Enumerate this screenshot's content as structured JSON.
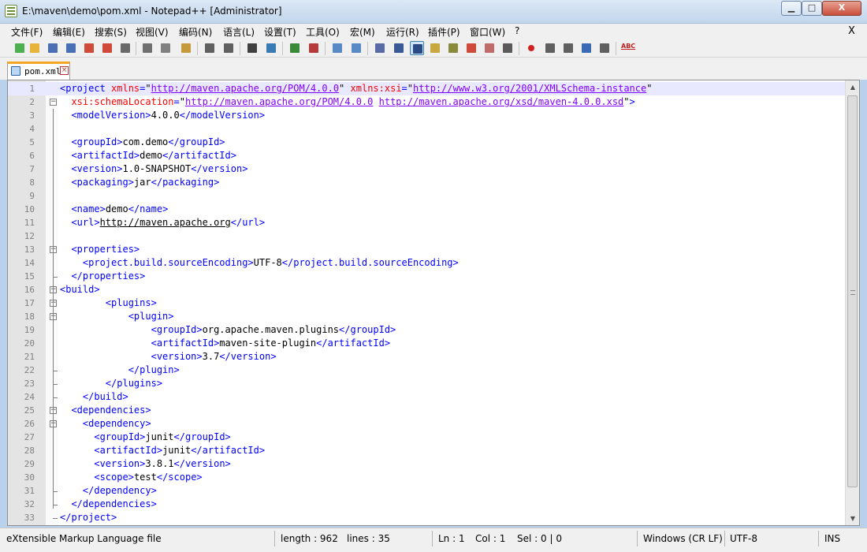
{
  "window": {
    "title": "E:\\maven\\demo\\pom.xml - Notepad++ [Administrator]",
    "minimize_label": "▁",
    "maximize_label": "□",
    "close_label": "X"
  },
  "menu": {
    "items": [
      "文件(F)",
      "编辑(E)",
      "搜索(S)",
      "视图(V)",
      "编码(N)",
      "语言(L)",
      "设置(T)",
      "工具(O)",
      "宏(M)",
      "运行(R)",
      "插件(P)",
      "窗口(W)",
      "?"
    ],
    "doc_close": "X"
  },
  "toolbar": {
    "icons": [
      "new-file-icon",
      "open-file-icon",
      "save-icon",
      "save-all-icon",
      "close-icon",
      "close-all-icon",
      "print-icon",
      "cut-icon",
      "copy-icon",
      "paste-icon",
      "undo-icon",
      "redo-icon",
      "find-icon",
      "replace-icon",
      "zoom-in-icon",
      "zoom-out-icon",
      "sync-v-icon",
      "sync-h-icon",
      "word-wrap-icon",
      "show-all-chars-icon",
      "indent-guide-icon",
      "doc-map-icon",
      "function-list-icon",
      "folder-workspace-icon",
      "monitor-icon",
      "eye-icon",
      "record-macro-icon",
      "stop-macro-icon",
      "play-macro-icon",
      "run-macro-multiple-icon",
      "save-macro-icon",
      "spell-check-icon"
    ],
    "colors": [
      "#4caf50",
      "#e8b33a",
      "#4a6fb5",
      "#4a6fb5",
      "#d04a3a",
      "#d04a3a",
      "#6a6a6a",
      "#707070",
      "#808080",
      "#c49a3c",
      "#606060",
      "#606060",
      "#404040",
      "#3a7ab5",
      "#3a8a3a",
      "#b53a3a",
      "#5a8ac5",
      "#5a8ac5",
      "#5a6aa5",
      "#3a5a95",
      "#2a4a85",
      "#c8a840",
      "#8a8a3a",
      "#d04a3a",
      "#c06a6a",
      "#5a5a5a",
      "#d02020",
      "#606060",
      "#606060",
      "#3a6ab5",
      "#606060",
      "#c02020"
    ],
    "spell_label": "ABC"
  },
  "tab": {
    "label": "pom.xml",
    "close": "×"
  },
  "editor": {
    "lines": [
      {
        "n": "1",
        "html": "<span class=\"t\">&lt;project</span> <span class=\"a\">xmlns</span><span class=\"t\">=</span><span class=\"q\">\"</span><span class=\"v\">http://maven.apache.org/POM/4.0.0</span><span class=\"q\">\"</span> <span class=\"a\">xmlns:xsi</span><span class=\"t\">=</span><span class=\"q\">\"</span><span class=\"v\">http://www.w3.org/2001/XMLSchema-instance</span><span class=\"q\">\"</span>"
      },
      {
        "n": "2",
        "html": "  <span class=\"a\">xsi:schemaLocation</span><span class=\"t\">=</span><span class=\"q\">\"</span><span class=\"v\">http://maven.apache.org/POM/4.0.0</span> <span class=\"v\">http://maven.apache.org/xsd/maven-4.0.0.xsd</span><span class=\"q\">\"</span><span class=\"t\">&gt;</span>"
      },
      {
        "n": "3",
        "html": "  <span class=\"t\">&lt;modelVersion&gt;</span>4.0.0<span class=\"t\">&lt;/modelVersion&gt;</span>"
      },
      {
        "n": "4",
        "html": ""
      },
      {
        "n": "5",
        "html": "  <span class=\"t\">&lt;groupId&gt;</span>com.demo<span class=\"t\">&lt;/groupId&gt;</span>"
      },
      {
        "n": "6",
        "html": "  <span class=\"t\">&lt;artifactId&gt;</span>demo<span class=\"t\">&lt;/artifactId&gt;</span>"
      },
      {
        "n": "7",
        "html": "  <span class=\"t\">&lt;version&gt;</span>1.0-SNAPSHOT<span class=\"t\">&lt;/version&gt;</span>"
      },
      {
        "n": "8",
        "html": "  <span class=\"t\">&lt;packaging&gt;</span>jar<span class=\"t\">&lt;/packaging&gt;</span>"
      },
      {
        "n": "9",
        "html": ""
      },
      {
        "n": "10",
        "html": "  <span class=\"t\">&lt;name&gt;</span>demo<span class=\"t\">&lt;/name&gt;</span>"
      },
      {
        "n": "11",
        "html": "  <span class=\"t\">&lt;url&gt;</span><span class=\"u\">http://maven.apache.org</span><span class=\"t\">&lt;/url&gt;</span>"
      },
      {
        "n": "12",
        "html": ""
      },
      {
        "n": "13",
        "html": "  <span class=\"t\">&lt;properties&gt;</span>"
      },
      {
        "n": "14",
        "html": "    <span class=\"t\">&lt;project.build.sourceEncoding&gt;</span>UTF-8<span class=\"t\">&lt;/project.build.sourceEncoding&gt;</span>"
      },
      {
        "n": "15",
        "html": "  <span class=\"t\">&lt;/properties&gt;</span>"
      },
      {
        "n": "16",
        "html": "<span class=\"t\">&lt;build&gt;</span>"
      },
      {
        "n": "17",
        "html": "        <span class=\"t\">&lt;plugins&gt;</span>"
      },
      {
        "n": "18",
        "html": "            <span class=\"t\">&lt;plugin&gt;</span>"
      },
      {
        "n": "19",
        "html": "                <span class=\"t\">&lt;groupId&gt;</span>org.apache.maven.plugins<span class=\"t\">&lt;/groupId&gt;</span>"
      },
      {
        "n": "20",
        "html": "                <span class=\"t\">&lt;artifactId&gt;</span>maven-site-plugin<span class=\"t\">&lt;/artifactId&gt;</span>"
      },
      {
        "n": "21",
        "html": "                <span class=\"t\">&lt;version&gt;</span>3.7<span class=\"t\">&lt;/version&gt;</span>"
      },
      {
        "n": "22",
        "html": "            <span class=\"t\">&lt;/plugin&gt;</span>"
      },
      {
        "n": "23",
        "html": "        <span class=\"t\">&lt;/plugins&gt;</span>"
      },
      {
        "n": "24",
        "html": "    <span class=\"t\">&lt;/build&gt;</span>"
      },
      {
        "n": "25",
        "html": "  <span class=\"t\">&lt;dependencies&gt;</span>"
      },
      {
        "n": "26",
        "html": "    <span class=\"t\">&lt;dependency&gt;</span>"
      },
      {
        "n": "27",
        "html": "      <span class=\"t\">&lt;groupId&gt;</span>junit<span class=\"t\">&lt;/groupId&gt;</span>"
      },
      {
        "n": "28",
        "html": "      <span class=\"t\">&lt;artifactId&gt;</span>junit<span class=\"t\">&lt;/artifactId&gt;</span>"
      },
      {
        "n": "29",
        "html": "      <span class=\"t\">&lt;version&gt;</span>3.8.1<span class=\"t\">&lt;/version&gt;</span>"
      },
      {
        "n": "30",
        "html": "      <span class=\"t\">&lt;scope&gt;</span>test<span class=\"t\">&lt;/scope&gt;</span>"
      },
      {
        "n": "31",
        "html": "    <span class=\"t\">&lt;/dependency&gt;</span>"
      },
      {
        "n": "32",
        "html": "  <span class=\"t\">&lt;/dependencies&gt;</span>"
      },
      {
        "n": "33",
        "html": "<span class=\"t\">&lt;/project&gt;</span>"
      }
    ],
    "current_line": "1"
  },
  "status": {
    "file_type": "eXtensible Markup Language file",
    "length": "length : 962",
    "lines": "lines : 35",
    "ln": "Ln : 1",
    "col": "Col : 1",
    "sel": "Sel : 0 | 0",
    "eol": "Windows (CR LF)",
    "encoding": "UTF-8",
    "mode": "INS"
  }
}
